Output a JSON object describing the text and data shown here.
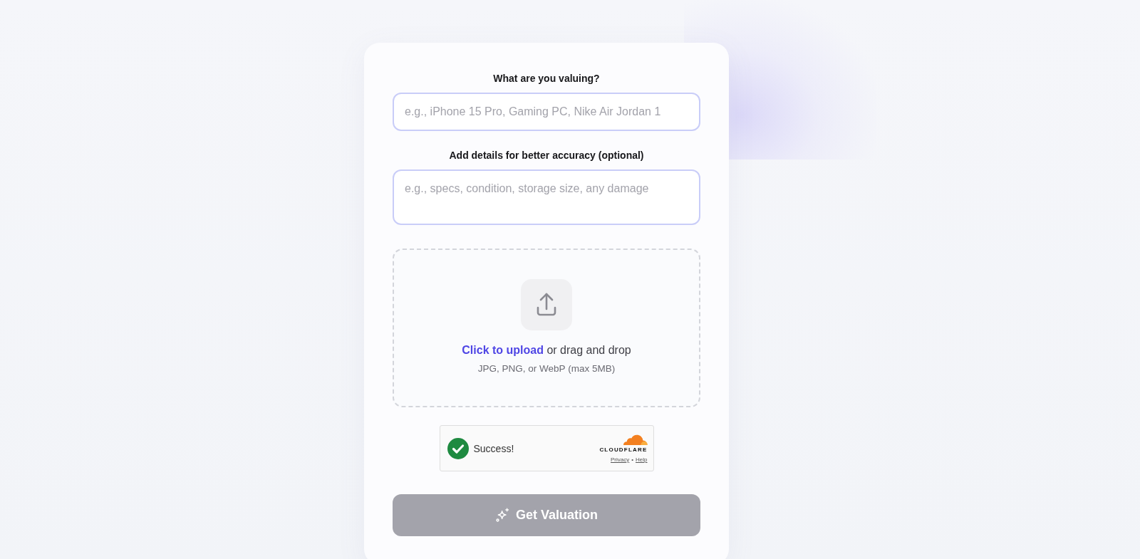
{
  "form": {
    "fields": [
      {
        "kind": "input",
        "label": "What are you valuing?",
        "placeholder": "e.g., iPhone 15 Pro, Gaming PC, Nike Air Jordan 1"
      },
      {
        "kind": "textarea",
        "label": "Add details for better accuracy (optional)",
        "placeholder": "e.g., specs, condition, storage size, any damage"
      }
    ],
    "upload": {
      "link": "Click to upload",
      "text": "or drag and drop",
      "hint": "JPG, PNG, or WebP (max 5MB)"
    },
    "captcha": {
      "verified": true,
      "status": "Success!",
      "brand": "CLOUDFLARE",
      "links": [
        "Privacy",
        "Help"
      ],
      "separator": "•"
    },
    "submit": {
      "label": "Get Valuation",
      "disabled": true
    }
  }
}
